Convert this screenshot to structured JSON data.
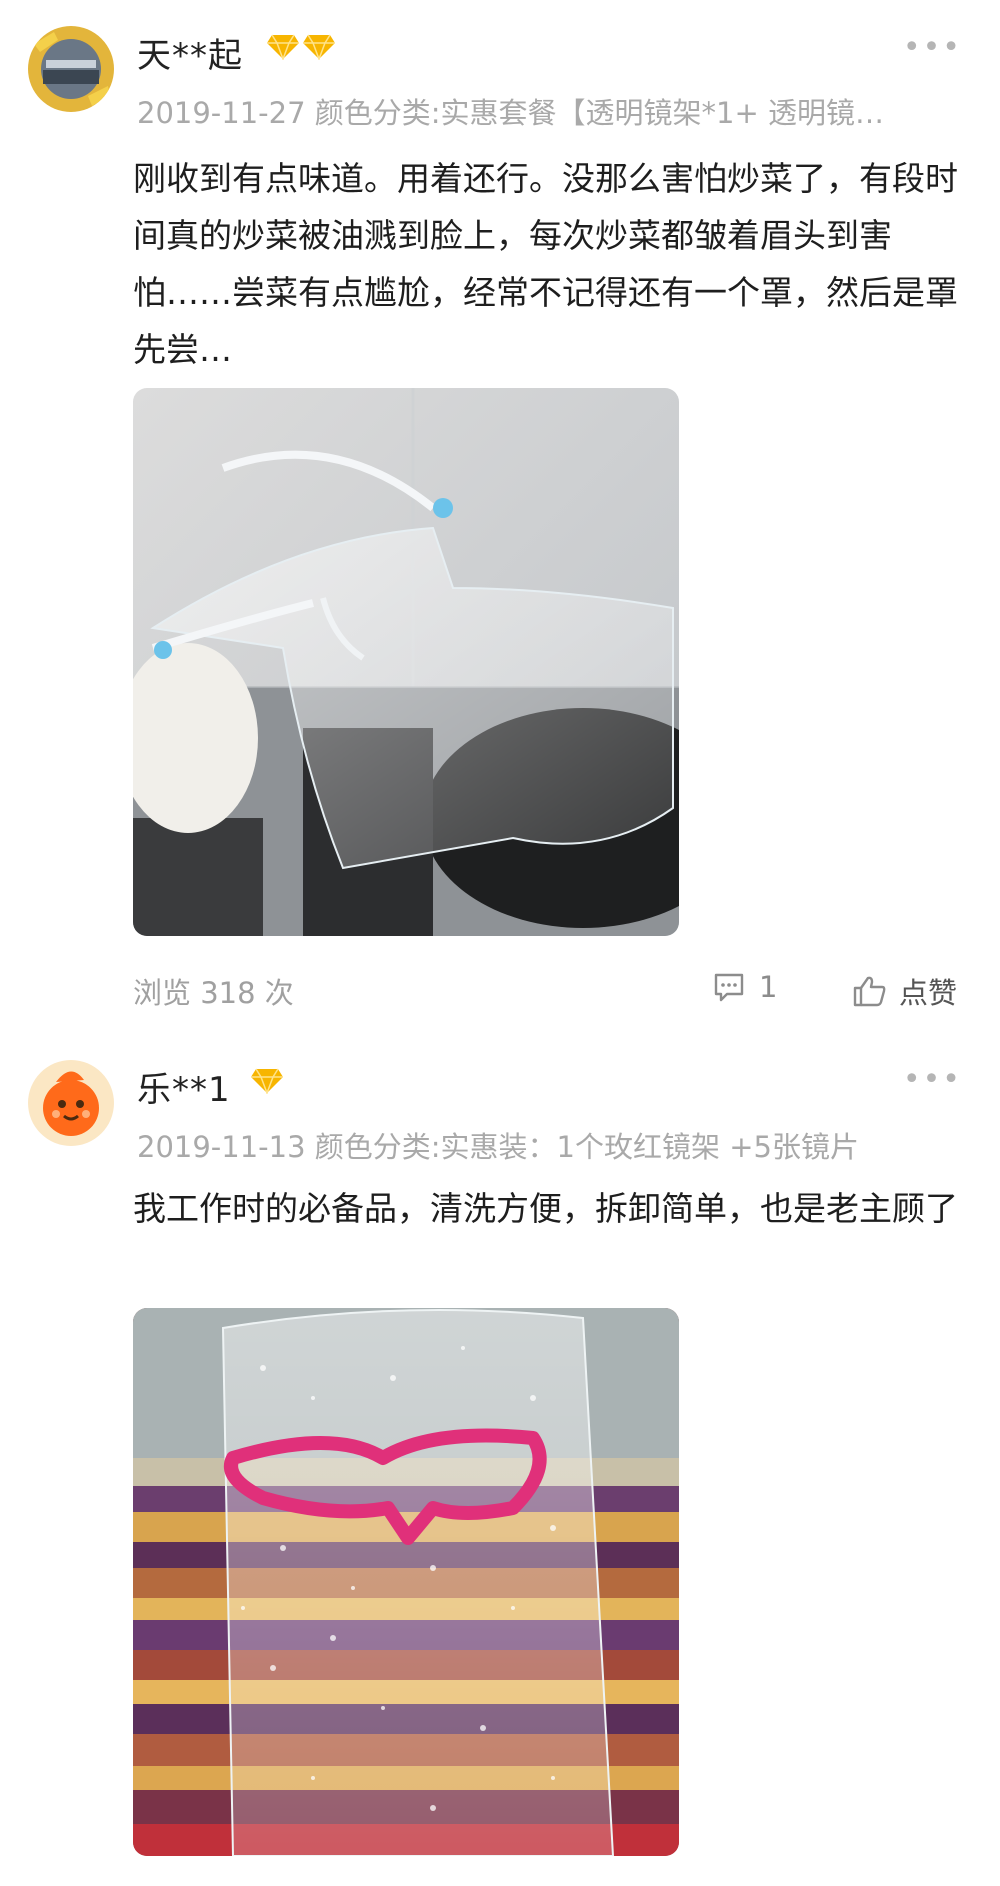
{
  "reviews": [
    {
      "username": "天**起",
      "badge_count": 2,
      "meta": "2019-11-27 颜色分类:实惠套餐【透明镜架*1+ 透明镜…",
      "content": "刚收到有点味道。用着还行。没那么害怕炒菜了，有段时间真的炒菜被油溅到脸上，每次炒菜都皱着眉头到害怕……尝菜有点尴尬，经常不记得还有一个罩，然后是罩先尝…",
      "views": "浏览 318 次",
      "comments": "1",
      "like_label": "点赞",
      "more": "•••"
    },
    {
      "username": "乐**1",
      "badge_count": 1,
      "meta": "2019-11-13 颜色分类:实惠装：1个玫红镜架 +5张镜片",
      "content": "我工作时的必备品，清洗方便，拆卸简单，也是老主顾了",
      "more": "•••"
    }
  ],
  "icons": {
    "badge": "diamond-icon",
    "comment": "comment-icon",
    "like": "thumbs-up-icon"
  },
  "colors": {
    "badge_gold": "#f7b500",
    "meta_gray": "#a9a9a9"
  }
}
